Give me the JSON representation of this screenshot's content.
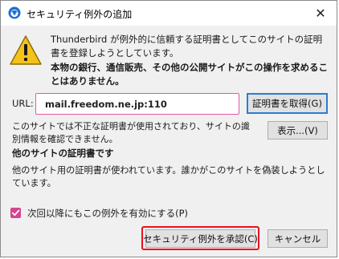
{
  "window": {
    "title": "セキュリティ例外の追加",
    "close_glyph": "✕",
    "title_icon": "thunderbird-icon"
  },
  "message": {
    "icon": "warning-icon",
    "line1": "Thunderbird が例外的に信頼する証明書としてこのサイトの証明書を登録しようとしています。",
    "line2": "本物の銀行、通信販売、その他の公開サイトがこの操作を求めることはありません。"
  },
  "url_row": {
    "label": "URL:",
    "value": "mail.freedom.ne.jp:110",
    "get_cert_button": "証明書を取得(G)"
  },
  "status": {
    "text": "このサイトでは不正な証明書が使用されており、サイトの識別情報を確認できません。",
    "view_button": "表示...(V)"
  },
  "other_site": {
    "heading": "他のサイトの証明書です",
    "description": "他のサイト用の証明書が使われています。誰かがこのサイトを偽装しようとしています。"
  },
  "permanent": {
    "checked": true,
    "label": "次回以降にもこの例外を有効にする(P)"
  },
  "buttons": {
    "confirm": "セキュリティ例外を承認(C)",
    "cancel": "キャンセル"
  },
  "colors": {
    "accent_pink": "#d6448f",
    "highlight_red": "#e8111d",
    "focus_blue": "#2b7bd3"
  }
}
